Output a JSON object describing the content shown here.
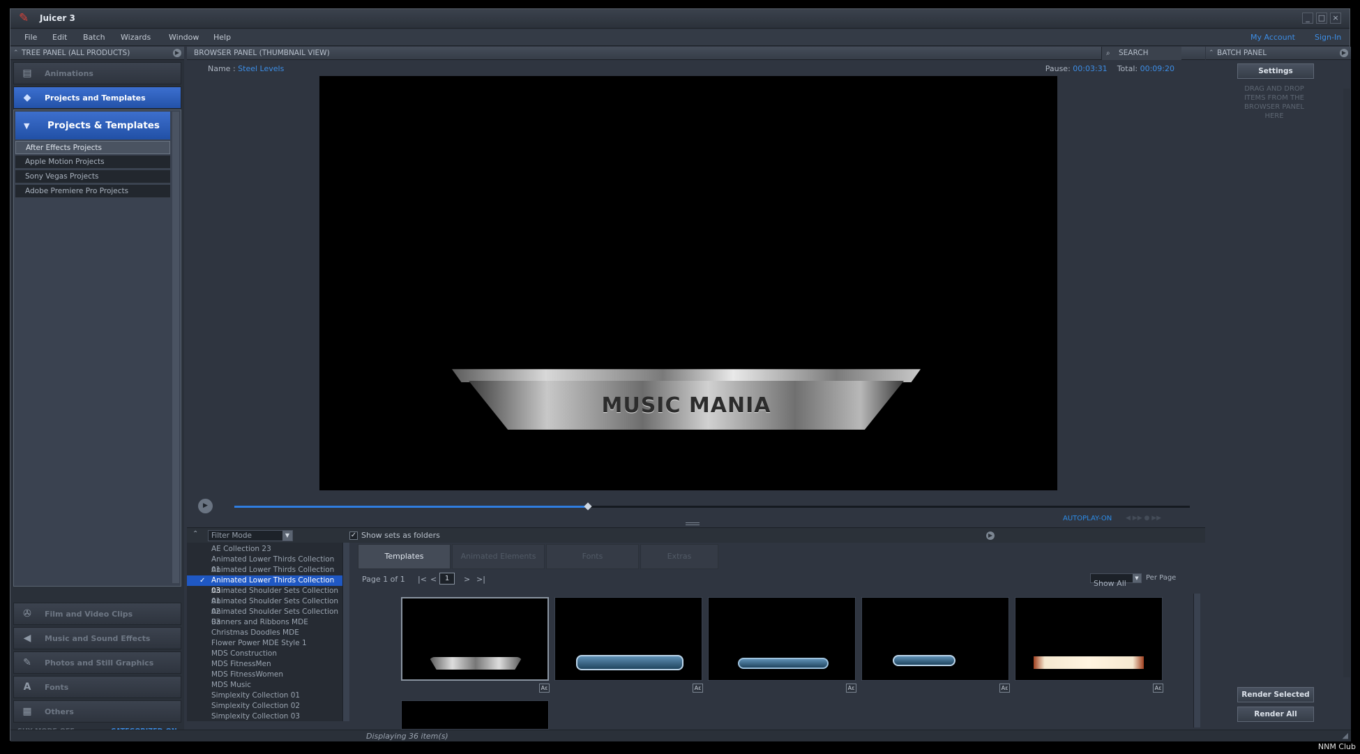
{
  "app": {
    "title": "Juicer 3",
    "account": "My Account",
    "signin": "Sign-In"
  },
  "menu": [
    "File",
    "Edit",
    "Batch",
    "Wizards",
    "Window",
    "Help"
  ],
  "tree_panel": {
    "title": "TREE PANEL (ALL PRODUCTS)",
    "nav_top": [
      "Animations",
      "Projects and Templates"
    ],
    "section_title": "Projects & Templates",
    "items": [
      "After Effects Projects",
      "Apple Motion Projects",
      "Sony Vegas Projects",
      "Adobe Premiere Pro Projects"
    ],
    "nav_bottom": [
      "Film and Video Clips",
      "Music and Sound Effects",
      "Photos and Still Graphics",
      "Fonts",
      "Others"
    ],
    "footer_left": "SHY MODE-OFF",
    "footer_right": "CATEGORIZED-ON"
  },
  "browser": {
    "title": "BROWSER PANEL (THUMBNAIL VIEW)",
    "search_label": "SEARCH",
    "name_label": "Name :",
    "name_value": "Steel Levels",
    "pause_label": "Pause:",
    "pause_value": "00:03:31",
    "total_label": "Total:",
    "total_value": "00:09:20",
    "video_text": "MUSIC MANIA",
    "progress": 0.37,
    "autoplay": "AUTOPLAY-ON",
    "filter_mode": "Filter Mode",
    "show_sets_label": "Show sets as folders",
    "show_sets_checked": true,
    "sets": [
      "AE Collection 23",
      "Animated Lower Thirds Collection 01",
      "Animated Lower Thirds Collection 02",
      "Animated Lower Thirds Collection 03",
      "Animated Shoulder Sets Collection 01",
      "Animated Shoulder Sets Collection 02",
      "Animated Shoulder Sets Collection 03",
      "Banners and Ribbons MDE",
      "Christmas Doodles MDE",
      "Flower Power MDE Style 1",
      "MDS Construction",
      "MDS FitnessMen",
      "MDS FitnessWomen",
      "MDS Music",
      "Simplexity Collection 01",
      "Simplexity Collection 02",
      "Simplexity Collection 03"
    ],
    "selected_set": "Animated Lower Thirds Collection 03",
    "tabs": [
      "Templates",
      "Animated Elements",
      "Fonts",
      "Extras"
    ],
    "page_text": "Page 1 of 1",
    "page_first": "|<",
    "page_prev": "<",
    "page_num": "1",
    "page_next": ">",
    "page_last": ">|",
    "show_all": "Show All",
    "per_page": "Per Page",
    "thumb_button": "Aε",
    "status": "Displaying 36 item(s)"
  },
  "batch": {
    "title": "BATCH PANEL",
    "settings": "Settings",
    "drop_text": "DRAG AND DROP ITEMS FROM THE BROWSER PANEL HERE",
    "render_selected": "Render Selected",
    "render_all": "Render All"
  },
  "watermark": "NNM Club"
}
